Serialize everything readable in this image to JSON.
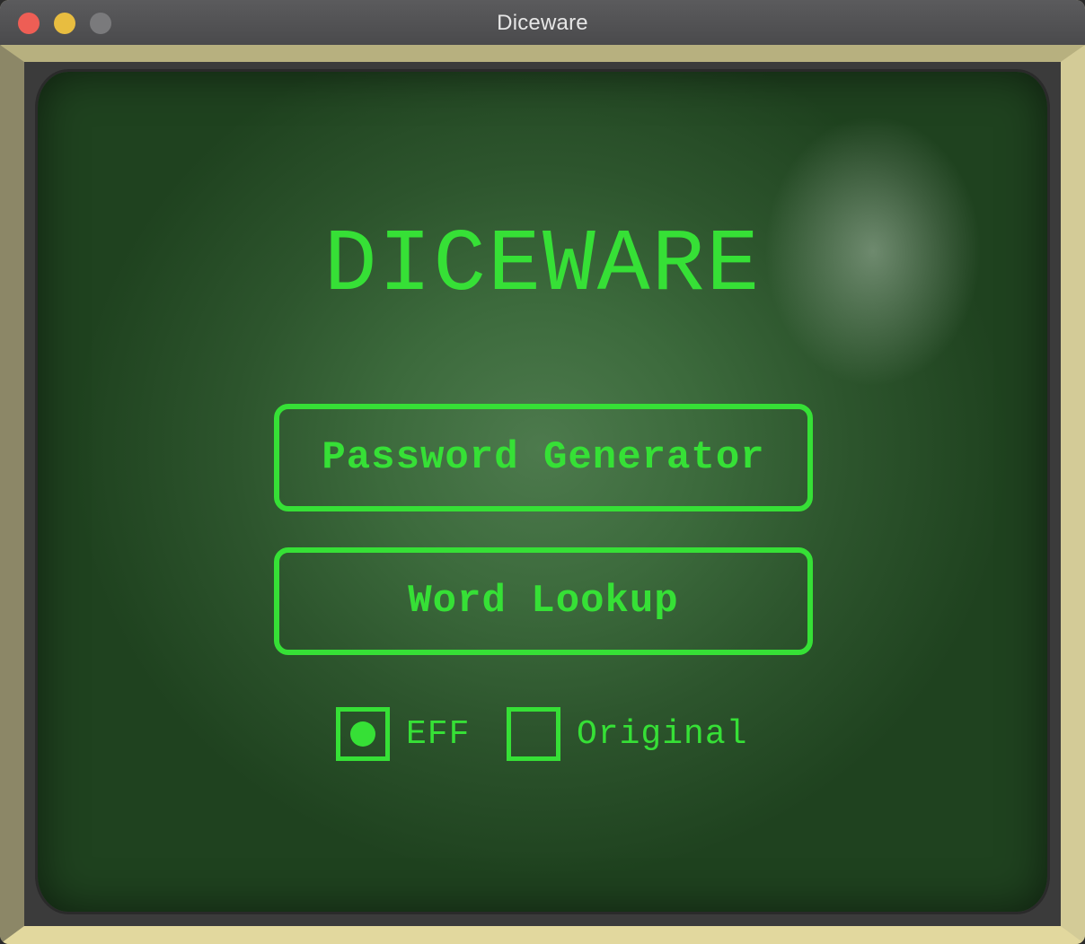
{
  "window": {
    "title": "Diceware"
  },
  "screen": {
    "heading": "DICEWARE",
    "buttons": {
      "password_generator": "Password Generator",
      "word_lookup": "Word Lookup"
    },
    "wordlist_options": [
      {
        "label": "EFF",
        "selected": true
      },
      {
        "label": "Original",
        "selected": false
      }
    ]
  },
  "colors": {
    "accent": "#36e036",
    "bezel": "#c9c190",
    "screen": "#2d552d"
  }
}
